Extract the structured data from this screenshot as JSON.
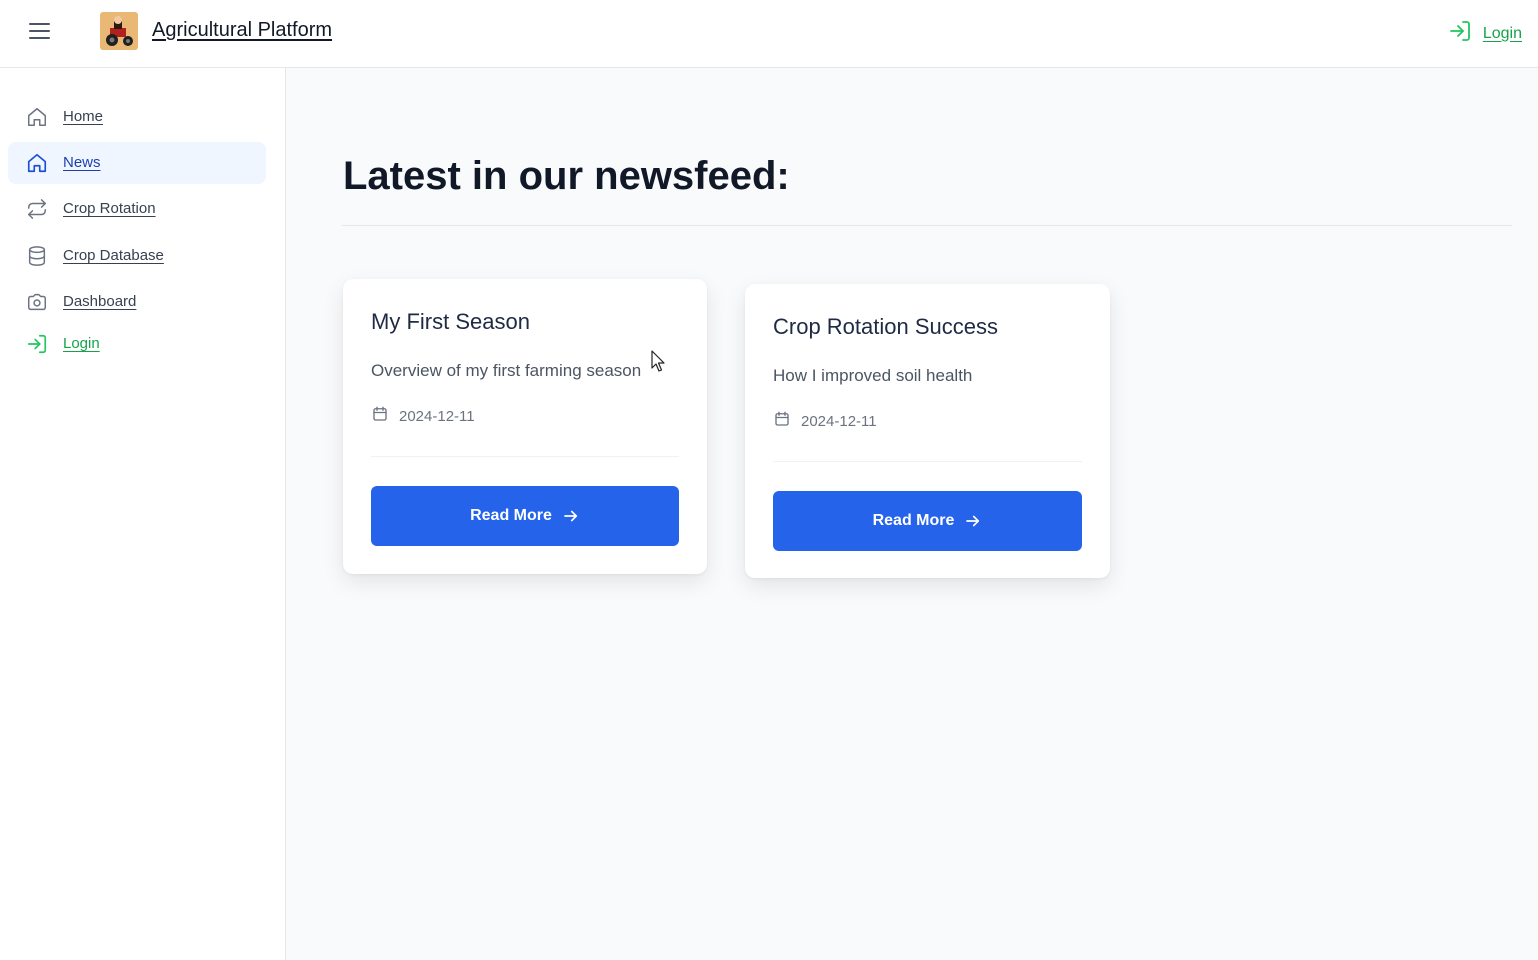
{
  "header": {
    "brand": "Agricultural Platform",
    "login_label": "Login"
  },
  "sidebar": {
    "items": [
      {
        "label": "Home",
        "icon": "home-icon",
        "active": false
      },
      {
        "label": "News",
        "icon": "home-icon",
        "active": true
      },
      {
        "label": "Crop Rotation",
        "icon": "repeat-icon",
        "active": false
      },
      {
        "label": "Crop Database",
        "icon": "database-icon",
        "active": false
      },
      {
        "label": "Dashboard",
        "icon": "camera-icon",
        "active": false
      },
      {
        "label": "Login",
        "icon": "login-icon",
        "active": false
      }
    ]
  },
  "main": {
    "heading": "Latest in our newsfeed:",
    "cards": [
      {
        "title": "My First Season",
        "description": "Overview of my first farming season",
        "date": "2024-12-11",
        "button": "Read More"
      },
      {
        "title": "Crop Rotation Success",
        "description": "How I improved soil health",
        "date": "2024-12-11",
        "button": "Read More"
      }
    ]
  },
  "colors": {
    "primary": "#2563eb",
    "active_bg": "#eff6ff",
    "login_green": "#16a34a",
    "page_bg": "#f9fafb"
  }
}
